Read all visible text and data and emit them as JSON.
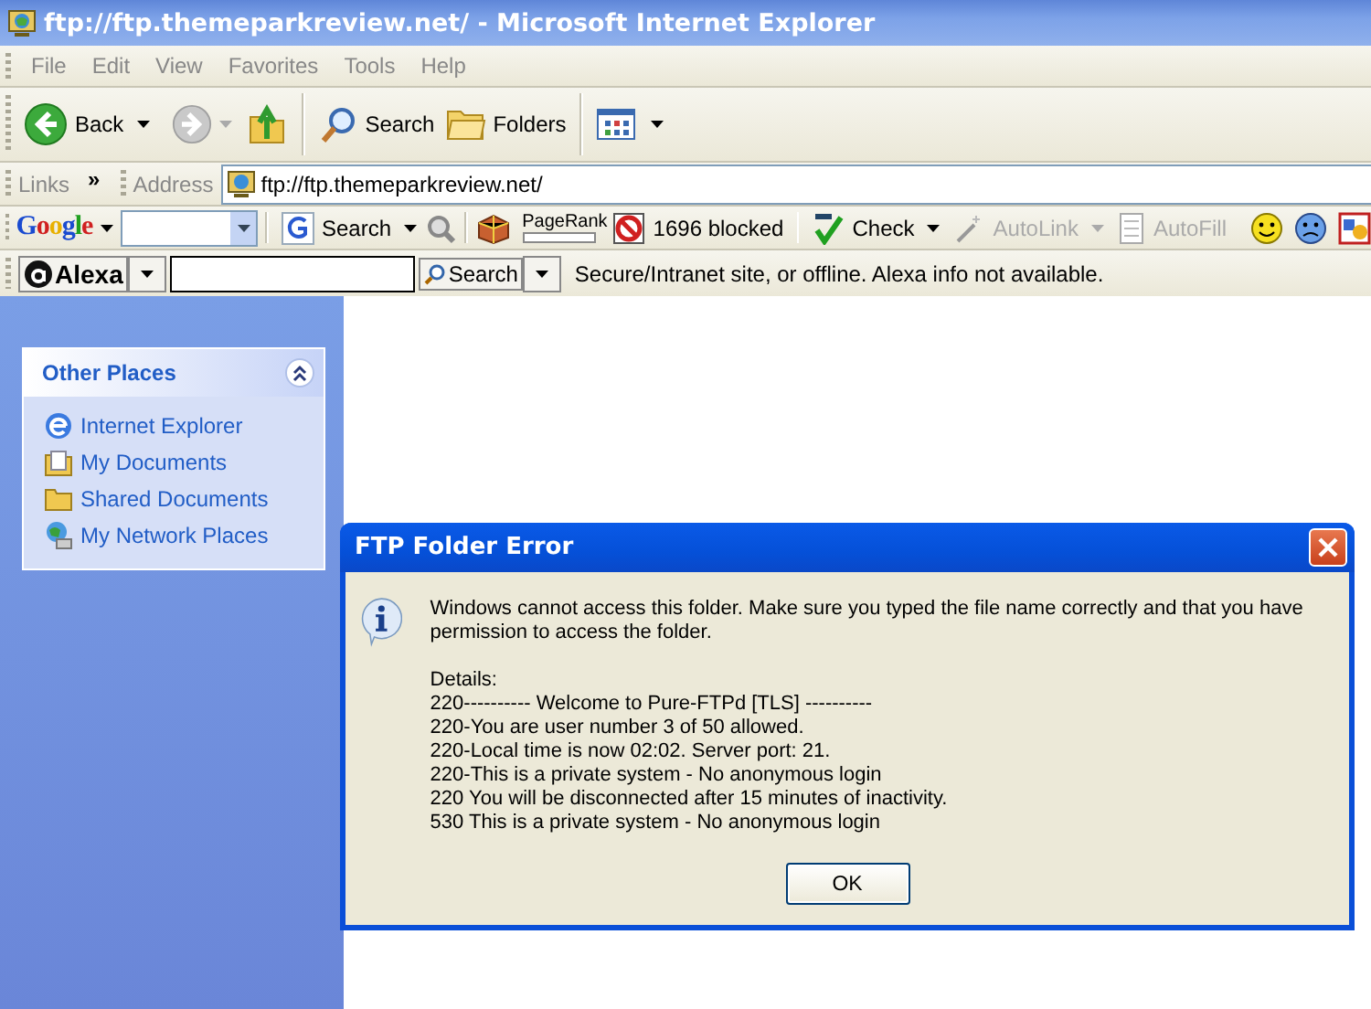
{
  "window": {
    "title": "ftp://ftp.themeparkreview.net/ - Microsoft Internet Explorer"
  },
  "menu": [
    "File",
    "Edit",
    "View",
    "Favorites",
    "Tools",
    "Help"
  ],
  "toolbar": {
    "back": "Back",
    "search": "Search",
    "folders": "Folders"
  },
  "address_bar": {
    "links": "Links",
    "chevron": "»",
    "label": "Address",
    "url": "ftp://ftp.themeparkreview.net/"
  },
  "google_bar": {
    "logo": "Google",
    "search": "Search",
    "pagerank": "PageRank",
    "blocked": "1696 blocked",
    "tools": [
      {
        "label": "Check",
        "disabled": false
      },
      {
        "label": "AutoLink",
        "disabled": true
      },
      {
        "label": "AutoFill",
        "disabled": true
      }
    ]
  },
  "alexa_bar": {
    "logo": "Alexa",
    "search": "Search",
    "status": "Secure/Intranet site, or offline. Alexa info not available."
  },
  "sidebar": {
    "title": "Other Places",
    "expanded": true,
    "items": [
      {
        "label": "Internet Explorer",
        "kind": "browser"
      },
      {
        "label": "My Documents",
        "kind": "documents"
      },
      {
        "label": "Shared Documents",
        "kind": "folder"
      },
      {
        "label": "My Network Places",
        "kind": "network"
      }
    ]
  },
  "dialog": {
    "title": "FTP Folder Error",
    "message": "Windows cannot access this folder. Make sure you typed the file name correctly and that you have permission to access the folder.",
    "details": [
      "Details:",
      "220---------- Welcome to Pure-FTPd [TLS] ----------",
      "220-You are user number 3 of 50 allowed.",
      "220-Local time is now 02:02. Server port: 21.",
      "220-This is a private system - No anonymous login",
      "220 You will be disconnected after 15 minutes of inactivity.",
      "530 This is a private system - No anonymous login"
    ],
    "ok": "OK"
  }
}
